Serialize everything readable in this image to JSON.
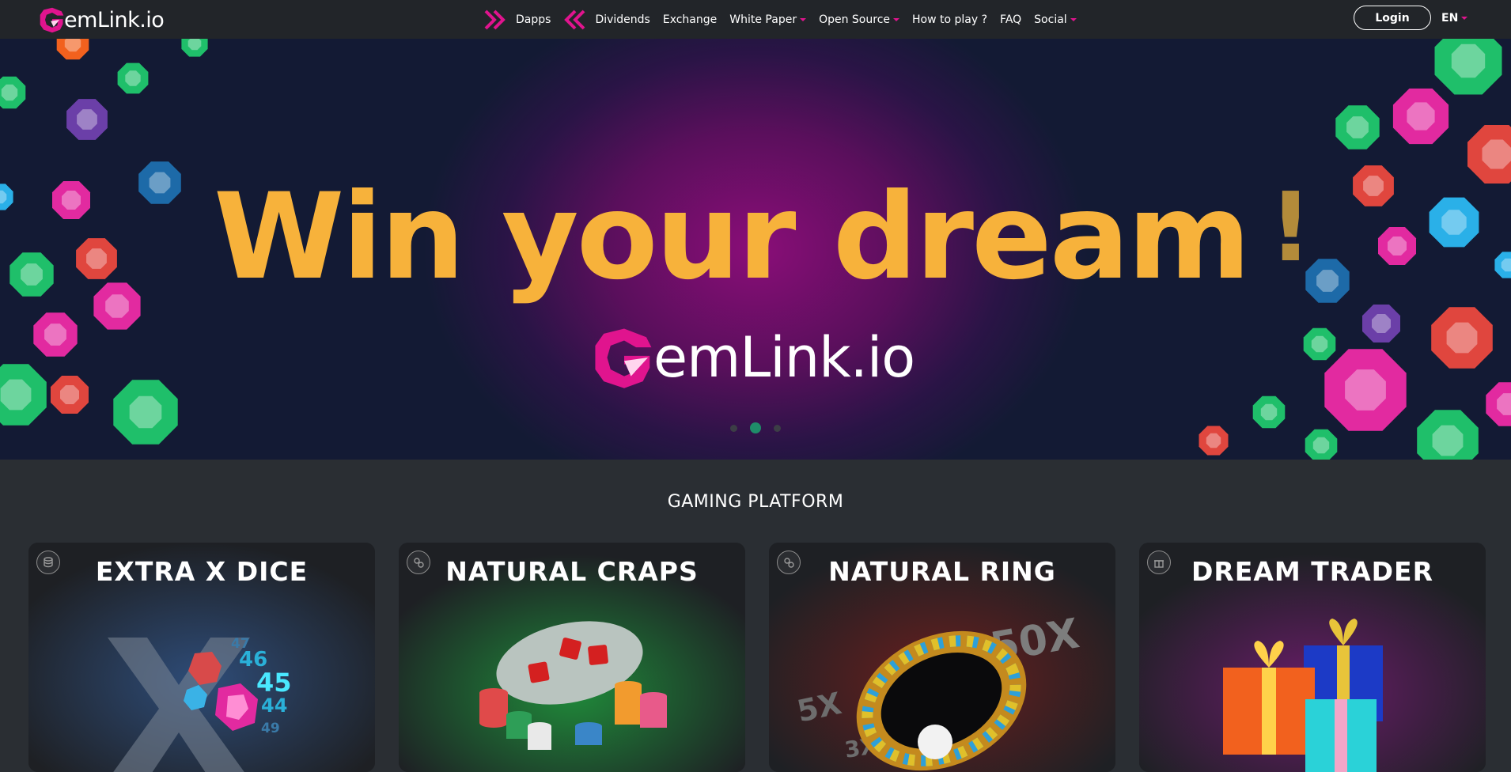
{
  "brand": {
    "logo_text": "emLink.io"
  },
  "nav": {
    "items": [
      {
        "label": "Dapps"
      },
      {
        "label": "Dividends"
      },
      {
        "label": "Exchange"
      },
      {
        "label": "White Paper"
      },
      {
        "label": "Open Source"
      },
      {
        "label": "How to play ?"
      },
      {
        "label": "FAQ"
      },
      {
        "label": "Social"
      }
    ],
    "login_label": "Login",
    "language": "EN"
  },
  "hero": {
    "headline": "Win your dream",
    "exclamation": "!",
    "logo_text": "emLink.io",
    "slides": 3,
    "active_slide": 2
  },
  "section": {
    "title": "GAMING PLATFORM"
  },
  "games": [
    {
      "title": "EXTRA X DICE",
      "numbers": [
        "47",
        "46",
        "45",
        "44",
        "49"
      ]
    },
    {
      "title": "NATURAL CRAPS"
    },
    {
      "title": "NATURAL RING",
      "multipliers": [
        "50X",
        "5X",
        "3X"
      ]
    },
    {
      "title": "DREAM TRADER"
    }
  ],
  "colors": {
    "accent": "#e0148e",
    "headline": "#f7b23b",
    "active_dot": "#1f8c69"
  }
}
